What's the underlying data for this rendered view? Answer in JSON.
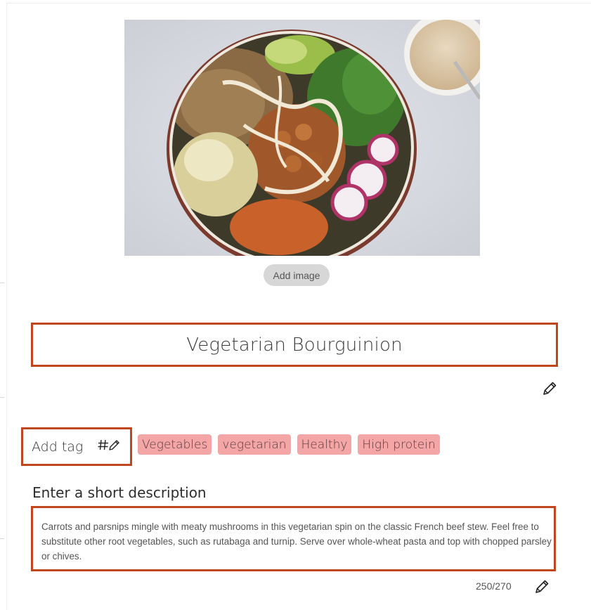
{
  "image": {
    "alt": "Vegetarian buddha bowl",
    "add_image_label": "Add image"
  },
  "recipe": {
    "title": "Vegetarian Bourguinion"
  },
  "tags": {
    "add_tag_label": "Add tag",
    "items": [
      "Vegetables",
      "vegetarian",
      "Healthy",
      "High protein"
    ]
  },
  "description": {
    "heading": "Enter a short description",
    "text": "Carrots and parsnips mingle with meaty mushrooms in this vegetarian spin on the classic French beef stew. Feel free to substitute other root vegetables, such as rutabaga and turnip. Serve over whole-wheat pasta and top with chopped parsley or chives.",
    "char_count": "250/270"
  },
  "colors": {
    "highlight_border": "#c0471d",
    "tag_bg": "#f4a6a6",
    "button_bg": "#d7d7d7"
  },
  "icons": {
    "title_edit": "pencil-icon",
    "tag_edit": "hashtag-pencil-icon",
    "description_edit": "pencil-icon"
  }
}
